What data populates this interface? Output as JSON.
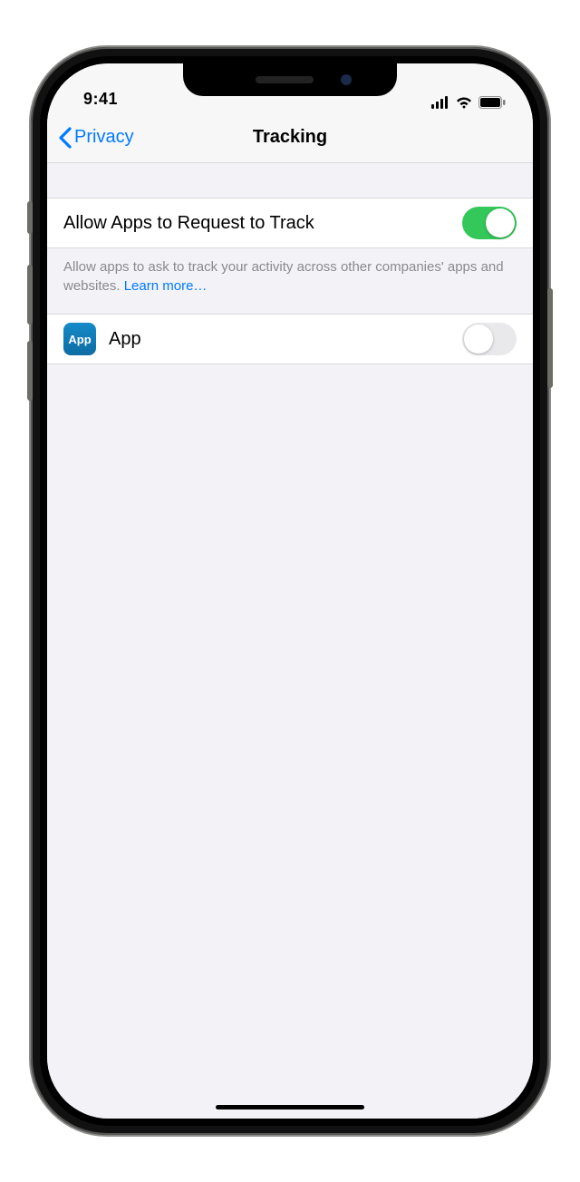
{
  "status": {
    "time": "9:41"
  },
  "nav": {
    "back_label": "Privacy",
    "title": "Tracking"
  },
  "allow_cell": {
    "label": "Allow Apps to Request to Track",
    "toggle_on": true
  },
  "allow_footer": {
    "text": "Allow apps to ask to track your activity across other companies' apps and websites. ",
    "link": "Learn more…"
  },
  "app_row": {
    "icon_text": "App",
    "label": "App",
    "toggle_on": false
  }
}
